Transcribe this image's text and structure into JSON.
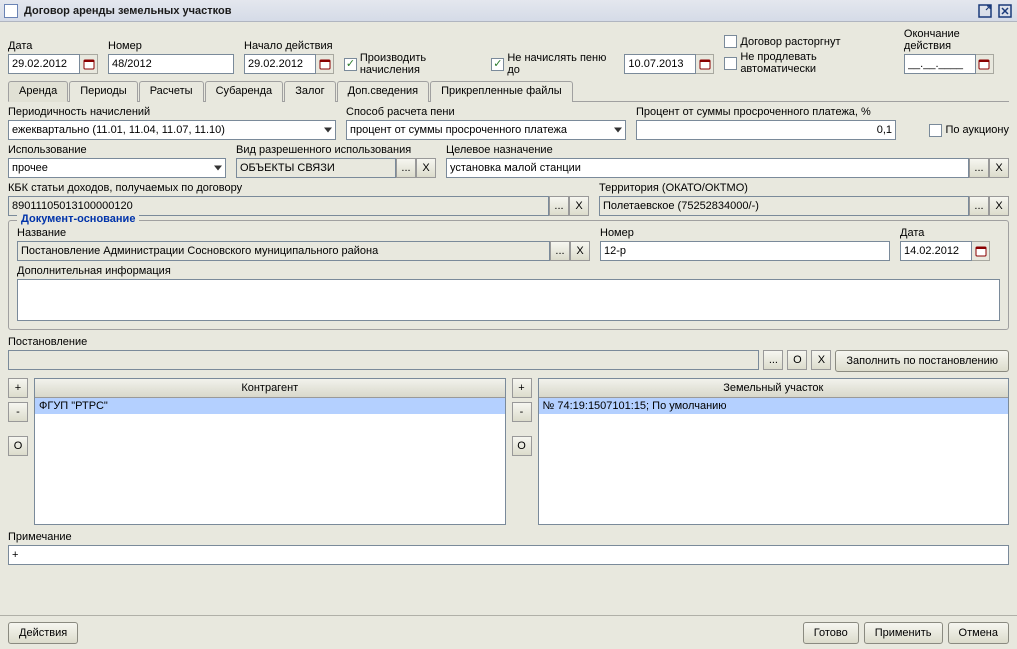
{
  "title": "Договор аренды земельных участков",
  "topfields": {
    "date_label": "Дата",
    "date_value": "29.02.2012",
    "number_label": "Номер",
    "number_value": "48/2012",
    "startdate_label": "Начало действия",
    "startdate_value": "29.02.2012",
    "produce_accruals_label": "Производить начисления",
    "no_penalty_until_label": "Не начислять пеню до",
    "no_penalty_until_value": "10.07.2013",
    "contract_terminated_label": "Договор расторгнут",
    "no_auto_extend_label": "Не продлевать автоматически",
    "enddate_label": "Окончание действия",
    "enddate_value": "__.__.____"
  },
  "tabs": {
    "t1": "Аренда",
    "t2": "Периоды",
    "t3": "Расчеты",
    "t4": "Субаренда",
    "t5": "Залог",
    "t6": "Доп.сведения",
    "t7": "Прикрепленные файлы"
  },
  "form": {
    "periodicity_label": "Периодичность начислений",
    "periodicity_value": "ежеквартально (11.01, 11.04, 11.07, 11.10)",
    "penalty_method_label": "Способ расчета пени",
    "penalty_method_value": "процент от суммы просроченного платежа",
    "percent_label": "Процент от суммы просроченного платежа, %",
    "percent_value": "0,1",
    "by_auction_label": "По аукциону",
    "use_label": "Использование",
    "use_value": "прочее",
    "permitted_use_label": "Вид разрешенного использования",
    "permitted_use_value": "ОБЪЕКТЫ СВЯЗИ",
    "ellipsis": "...",
    "x": "X",
    "letter_o": "O",
    "target_purpose_label": "Целевое назначение",
    "target_purpose_value": "установка малой станции",
    "kbk_label": "КБК статьи доходов, получаемых по договору",
    "kbk_value": "89011105013100000120",
    "territory_label": "Территория (ОКАТО/ОКТМО)",
    "territory_value": "Полетаевское (75252834000/-)",
    "doc_basis_legend": "Документ-основание",
    "doc_basis_name_label": "Название",
    "doc_basis_name_value": "Постановление Администрации Сосновского муниципального района",
    "doc_basis_number_label": "Номер",
    "doc_basis_number_value": "12-р",
    "doc_basis_date_label": "Дата",
    "doc_basis_date_value": "14.02.2012",
    "extra_info_label": "Дополнительная информация",
    "extra_info_value": "",
    "resolution_label": "Постановление",
    "fill_by_resolution_label": "Заполнить по постановлению",
    "plus": "+",
    "minus": "-",
    "counterparty_header": "Контрагент",
    "counterparty_row1": "ФГУП \"РТРС\"",
    "landplot_header": "Земельный участок",
    "landplot_row1": "№ 74:19:1507101:15; По умолчанию",
    "note_label": "Примечание",
    "note_value": "+"
  },
  "bottom": {
    "actions": "Действия",
    "done": "Готово",
    "apply": "Применить",
    "cancel": "Отмена"
  }
}
